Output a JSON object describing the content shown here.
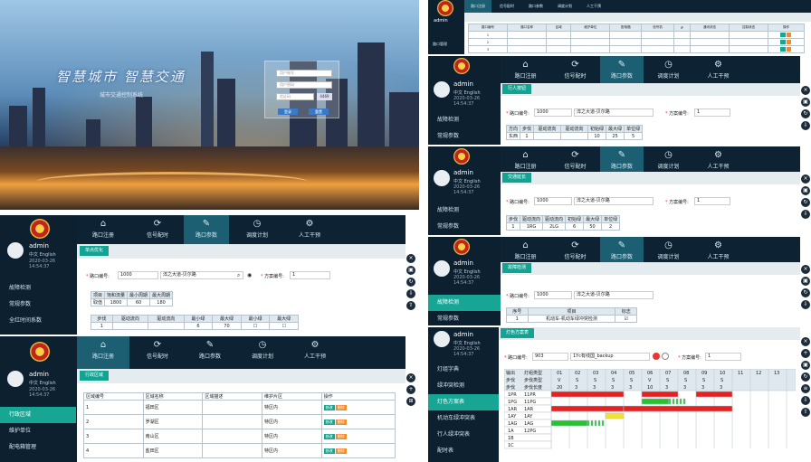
{
  "login": {
    "slogan": "智慧城市 智慧交通",
    "subtitle": "城市交通控制系统",
    "username_placeholder": "用户账号",
    "password_placeholder": "用户密码",
    "captcha_placeholder": "验证码",
    "captcha_text": "4469",
    "login_button": "登录",
    "reset_button": "重置"
  },
  "user": {
    "name": "admin",
    "lang_cn": "中文",
    "lang_en": "English",
    "date": "2020-03-26 14:54:37"
  },
  "nav": {
    "items": [
      "路口注册",
      "信号配时",
      "路口参数",
      "调度计划",
      "人工干预"
    ],
    "icons": [
      "home-icon",
      "sync-icon",
      "wrench-icon",
      "clock-icon",
      "gear-icon"
    ]
  },
  "panel_params": {
    "tab": "单点优化",
    "sidebar": [
      "故障检测",
      "常规参数",
      "全红时间系数"
    ],
    "junction_label": "路口编号:",
    "junction_value": "1000",
    "junction_name": "淬之大道-贝尔路",
    "plan_label": "方案编号:",
    "plan_value": "1",
    "table1_head": [
      "项目",
      "饱和流量",
      "最小周期",
      "最大周期"
    ],
    "table1_row": [
      "取值",
      "1800",
      "60",
      "180"
    ],
    "table2_head": [
      "步伐",
      "驱动流向",
      "驱动流向",
      "最小绿",
      "最大绿",
      "最小绿",
      "最大绿"
    ],
    "table2_row": [
      "1",
      "",
      "",
      "6",
      "70",
      "",
      ""
    ]
  },
  "panel_region": {
    "tab": "行政区域",
    "sidebar": [
      "行政区域",
      "维护单位",
      "配电箱管理"
    ],
    "head": [
      "区域编号",
      "区域名称",
      "区域描述",
      "维护片区",
      "操作"
    ],
    "rows": [
      [
        "1",
        "福田区",
        "",
        "特区内"
      ],
      [
        "2",
        "罗湖区",
        "",
        "特区内"
      ],
      [
        "3",
        "南山区",
        "",
        "特区内"
      ],
      [
        "4",
        "盐田区",
        "",
        "特区内"
      ]
    ],
    "edit": "修改",
    "delete": "删除"
  },
  "panel_list": {
    "left_label": "路口管理",
    "head": [
      "路口编号",
      "路口名称",
      "区域",
      "维护单位",
      "配电箱",
      "信号机",
      "IP",
      "通讯状态",
      "控制状态",
      "操作"
    ],
    "rows": [
      [
        "1",
        "",
        "",
        "",
        "",
        "",
        "",
        "",
        "",
        ""
      ],
      [
        "2",
        "",
        "",
        "",
        "",
        "",
        "",
        "",
        "",
        ""
      ],
      [
        "3",
        "",
        "",
        "",
        "",
        "",
        "",
        "",
        "",
        ""
      ]
    ]
  },
  "panel_pedestrian": {
    "tab": "行人按钮",
    "sidebar": [
      "故障检测",
      "常规参数"
    ],
    "junction_value": "1000",
    "junction_name": "淬之大道-贝尔路",
    "plan_value": "1",
    "head": [
      "方向",
      "步伐",
      "驱动流向",
      "驱动流向",
      "初始绿",
      "最大绿",
      "单位绿"
    ],
    "row": [
      "东西",
      "1",
      "",
      "",
      "10",
      "25",
      "5"
    ]
  },
  "panel_extend": {
    "tab": "交通延长",
    "sidebar": [
      "故障检测",
      "常规参数"
    ],
    "junction_value": "1000",
    "junction_name": "淬之大道-贝尔路",
    "plan_value": "1",
    "head": [
      "步伐",
      "驱动流向",
      "驱动流向",
      "初始绿",
      "最大绿",
      "单位绿"
    ],
    "row": [
      "1",
      "1RG",
      "2LG",
      "6",
      "50",
      "2"
    ]
  },
  "panel_fault": {
    "tab": "故障检测",
    "sidebar": [
      "故障检测",
      "常规参数"
    ],
    "junction_value": "1000",
    "junction_name": "淬之大道-贝尔路",
    "head": [
      "序号",
      "项目",
      "标志"
    ],
    "row": [
      "1",
      "机动车-机动车绿冲突检测",
      ""
    ]
  },
  "panel_lamp": {
    "tab": "灯色方案表",
    "sidebar": [
      "灯组字典",
      "绿冲突检测",
      "灯色方案表",
      "机动车绿冲突表",
      "行人绿冲突表",
      "配时表"
    ],
    "junction_value": "903",
    "junction_name": "1Yc有线国_backup",
    "plan_value": "1",
    "cols": [
      "01",
      "02",
      "03",
      "04",
      "05",
      "06",
      "07",
      "08",
      "09",
      "10",
      "11",
      "12",
      "13"
    ],
    "row_step": [
      "V",
      "S",
      "S",
      "S",
      "S",
      "V",
      "S",
      "S",
      "S",
      "S"
    ],
    "row_len": [
      "20",
      "3",
      "3",
      "3",
      "3",
      "10",
      "3",
      "3",
      "3",
      "3"
    ],
    "lamps": [
      {
        "out": "1PR",
        "name": "11PR"
      },
      {
        "out": "1PG",
        "name": "11PG"
      },
      {
        "out": "1AR",
        "name": "1AR"
      },
      {
        "out": "1AY",
        "name": "1AY"
      },
      {
        "out": "1AG",
        "name": "1AG"
      },
      {
        "out": "1A",
        "name": "12PG"
      },
      {
        "out": "1B",
        "name": ""
      },
      {
        "out": "1C",
        "name": ""
      }
    ],
    "label_out": "输出",
    "label_group": "灯组类型",
    "label_step": "步伐",
    "label_step_type": "步伐类型",
    "label_step_len": "步伐长度",
    "colors": {
      "red": "#e52222",
      "green": "#27c231",
      "yellow": "#f4e22a"
    }
  }
}
